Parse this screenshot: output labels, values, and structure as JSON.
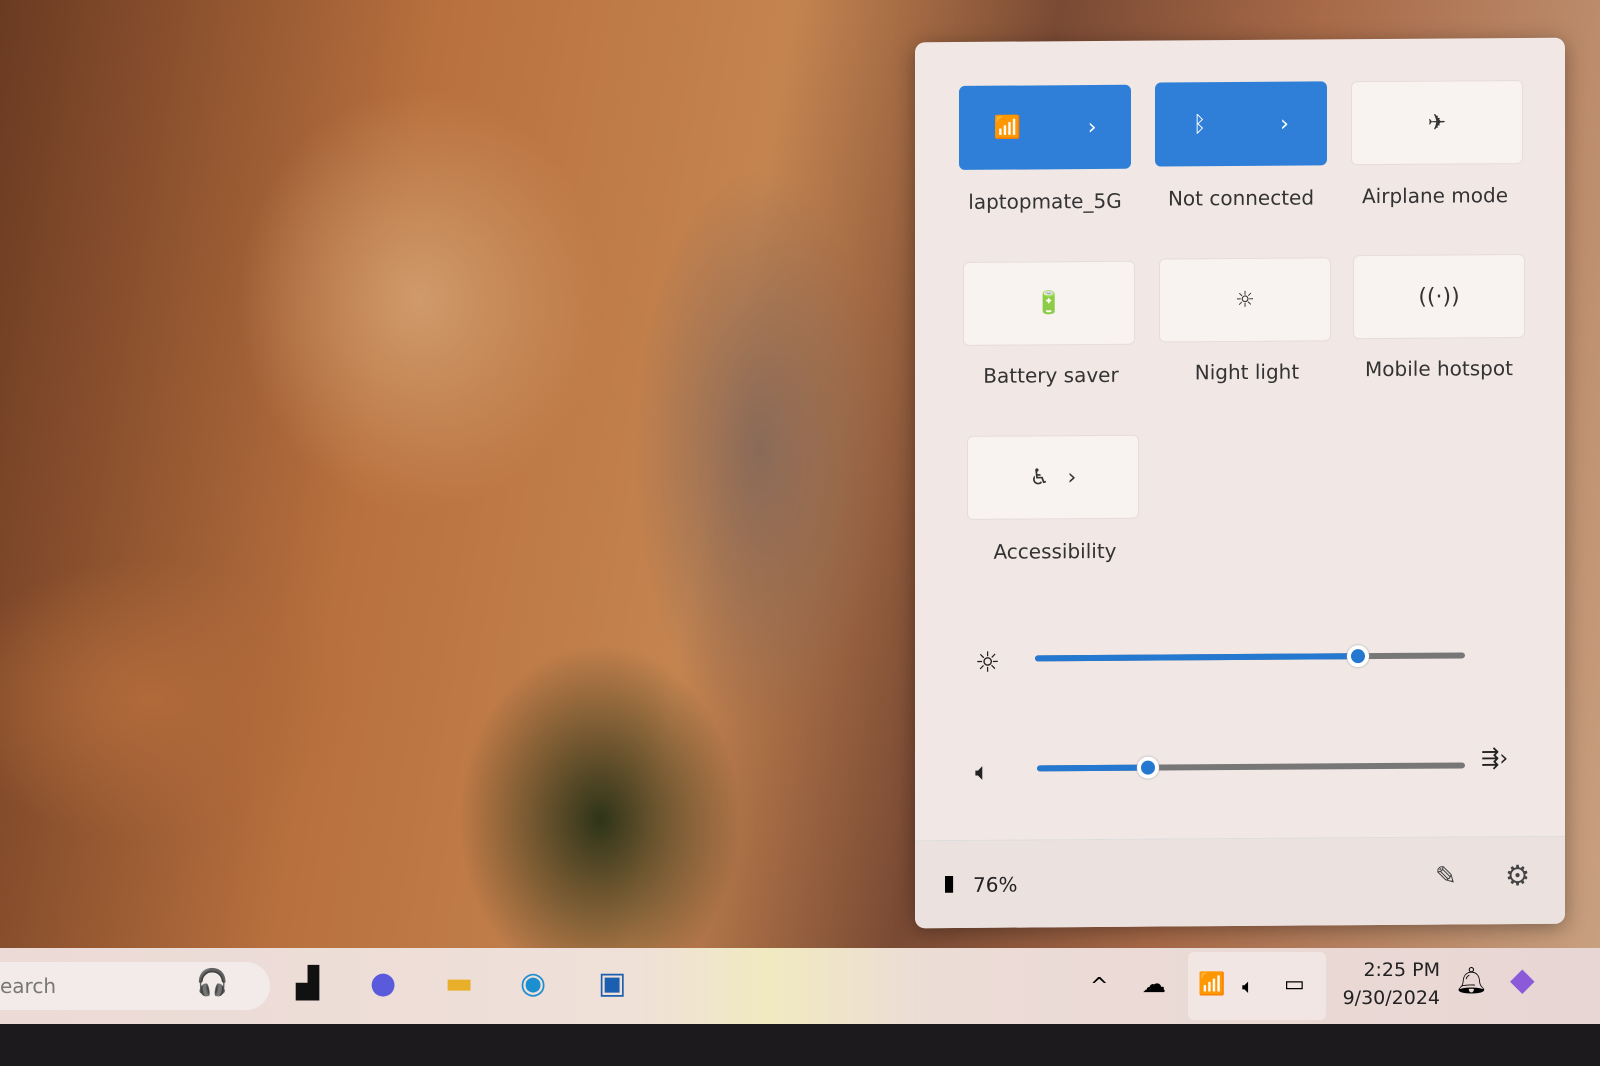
{
  "quick_settings": {
    "tiles": [
      {
        "label": "laptopmate_5G",
        "icon": "wifi-icon",
        "active": true,
        "expandable": true
      },
      {
        "label": "Not connected",
        "icon": "bluetooth-icon",
        "active": true,
        "expandable": true
      },
      {
        "label": "Airplane mode",
        "icon": "airplane-icon",
        "active": false
      },
      {
        "label": "Battery saver",
        "icon": "battery-saver-icon",
        "active": false
      },
      {
        "label": "Night light",
        "icon": "night-light-icon",
        "active": false
      },
      {
        "label": "Mobile hotspot",
        "icon": "hotspot-icon",
        "active": false
      },
      {
        "label": "Accessibility",
        "icon": "accessibility-icon",
        "active": false,
        "expandable": true
      }
    ],
    "brightness_percent": 75,
    "volume_percent": 26,
    "battery": "76%",
    "accent_color": "#2f7fd8"
  },
  "taskbar": {
    "search_placeholder": "earch",
    "time": "2:25 PM",
    "date": "9/30/2024"
  }
}
